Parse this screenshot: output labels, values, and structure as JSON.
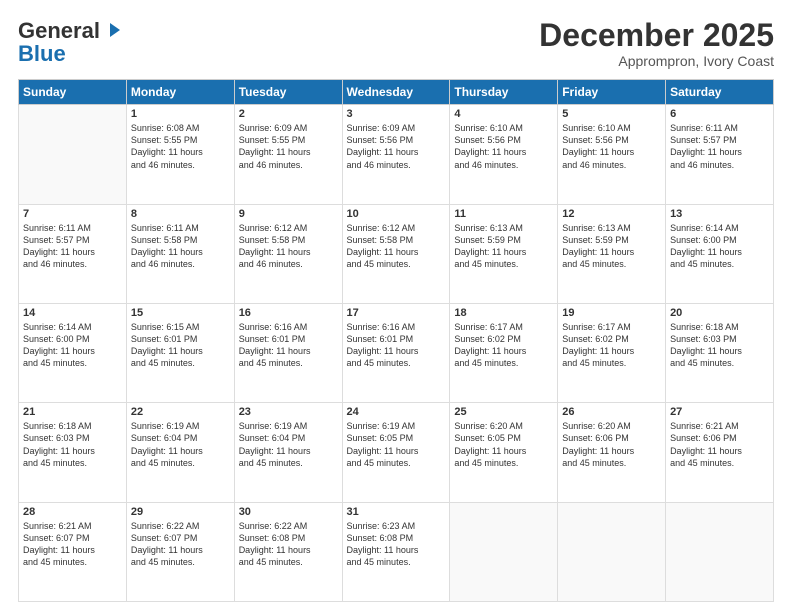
{
  "header": {
    "logo_line1": "General",
    "logo_line2": "Blue",
    "month_title": "December 2025",
    "location": "Apprompron, Ivory Coast"
  },
  "days_of_week": [
    "Sunday",
    "Monday",
    "Tuesday",
    "Wednesday",
    "Thursday",
    "Friday",
    "Saturday"
  ],
  "weeks": [
    [
      {
        "day": "",
        "info": ""
      },
      {
        "day": "1",
        "info": "Sunrise: 6:08 AM\nSunset: 5:55 PM\nDaylight: 11 hours\nand 46 minutes."
      },
      {
        "day": "2",
        "info": "Sunrise: 6:09 AM\nSunset: 5:55 PM\nDaylight: 11 hours\nand 46 minutes."
      },
      {
        "day": "3",
        "info": "Sunrise: 6:09 AM\nSunset: 5:56 PM\nDaylight: 11 hours\nand 46 minutes."
      },
      {
        "day": "4",
        "info": "Sunrise: 6:10 AM\nSunset: 5:56 PM\nDaylight: 11 hours\nand 46 minutes."
      },
      {
        "day": "5",
        "info": "Sunrise: 6:10 AM\nSunset: 5:56 PM\nDaylight: 11 hours\nand 46 minutes."
      },
      {
        "day": "6",
        "info": "Sunrise: 6:11 AM\nSunset: 5:57 PM\nDaylight: 11 hours\nand 46 minutes."
      }
    ],
    [
      {
        "day": "7",
        "info": "Sunrise: 6:11 AM\nSunset: 5:57 PM\nDaylight: 11 hours\nand 46 minutes."
      },
      {
        "day": "8",
        "info": "Sunrise: 6:11 AM\nSunset: 5:58 PM\nDaylight: 11 hours\nand 46 minutes."
      },
      {
        "day": "9",
        "info": "Sunrise: 6:12 AM\nSunset: 5:58 PM\nDaylight: 11 hours\nand 46 minutes."
      },
      {
        "day": "10",
        "info": "Sunrise: 6:12 AM\nSunset: 5:58 PM\nDaylight: 11 hours\nand 45 minutes."
      },
      {
        "day": "11",
        "info": "Sunrise: 6:13 AM\nSunset: 5:59 PM\nDaylight: 11 hours\nand 45 minutes."
      },
      {
        "day": "12",
        "info": "Sunrise: 6:13 AM\nSunset: 5:59 PM\nDaylight: 11 hours\nand 45 minutes."
      },
      {
        "day": "13",
        "info": "Sunrise: 6:14 AM\nSunset: 6:00 PM\nDaylight: 11 hours\nand 45 minutes."
      }
    ],
    [
      {
        "day": "14",
        "info": "Sunrise: 6:14 AM\nSunset: 6:00 PM\nDaylight: 11 hours\nand 45 minutes."
      },
      {
        "day": "15",
        "info": "Sunrise: 6:15 AM\nSunset: 6:01 PM\nDaylight: 11 hours\nand 45 minutes."
      },
      {
        "day": "16",
        "info": "Sunrise: 6:16 AM\nSunset: 6:01 PM\nDaylight: 11 hours\nand 45 minutes."
      },
      {
        "day": "17",
        "info": "Sunrise: 6:16 AM\nSunset: 6:01 PM\nDaylight: 11 hours\nand 45 minutes."
      },
      {
        "day": "18",
        "info": "Sunrise: 6:17 AM\nSunset: 6:02 PM\nDaylight: 11 hours\nand 45 minutes."
      },
      {
        "day": "19",
        "info": "Sunrise: 6:17 AM\nSunset: 6:02 PM\nDaylight: 11 hours\nand 45 minutes."
      },
      {
        "day": "20",
        "info": "Sunrise: 6:18 AM\nSunset: 6:03 PM\nDaylight: 11 hours\nand 45 minutes."
      }
    ],
    [
      {
        "day": "21",
        "info": "Sunrise: 6:18 AM\nSunset: 6:03 PM\nDaylight: 11 hours\nand 45 minutes."
      },
      {
        "day": "22",
        "info": "Sunrise: 6:19 AM\nSunset: 6:04 PM\nDaylight: 11 hours\nand 45 minutes."
      },
      {
        "day": "23",
        "info": "Sunrise: 6:19 AM\nSunset: 6:04 PM\nDaylight: 11 hours\nand 45 minutes."
      },
      {
        "day": "24",
        "info": "Sunrise: 6:19 AM\nSunset: 6:05 PM\nDaylight: 11 hours\nand 45 minutes."
      },
      {
        "day": "25",
        "info": "Sunrise: 6:20 AM\nSunset: 6:05 PM\nDaylight: 11 hours\nand 45 minutes."
      },
      {
        "day": "26",
        "info": "Sunrise: 6:20 AM\nSunset: 6:06 PM\nDaylight: 11 hours\nand 45 minutes."
      },
      {
        "day": "27",
        "info": "Sunrise: 6:21 AM\nSunset: 6:06 PM\nDaylight: 11 hours\nand 45 minutes."
      }
    ],
    [
      {
        "day": "28",
        "info": "Sunrise: 6:21 AM\nSunset: 6:07 PM\nDaylight: 11 hours\nand 45 minutes."
      },
      {
        "day": "29",
        "info": "Sunrise: 6:22 AM\nSunset: 6:07 PM\nDaylight: 11 hours\nand 45 minutes."
      },
      {
        "day": "30",
        "info": "Sunrise: 6:22 AM\nSunset: 6:08 PM\nDaylight: 11 hours\nand 45 minutes."
      },
      {
        "day": "31",
        "info": "Sunrise: 6:23 AM\nSunset: 6:08 PM\nDaylight: 11 hours\nand 45 minutes."
      },
      {
        "day": "",
        "info": ""
      },
      {
        "day": "",
        "info": ""
      },
      {
        "day": "",
        "info": ""
      }
    ]
  ]
}
